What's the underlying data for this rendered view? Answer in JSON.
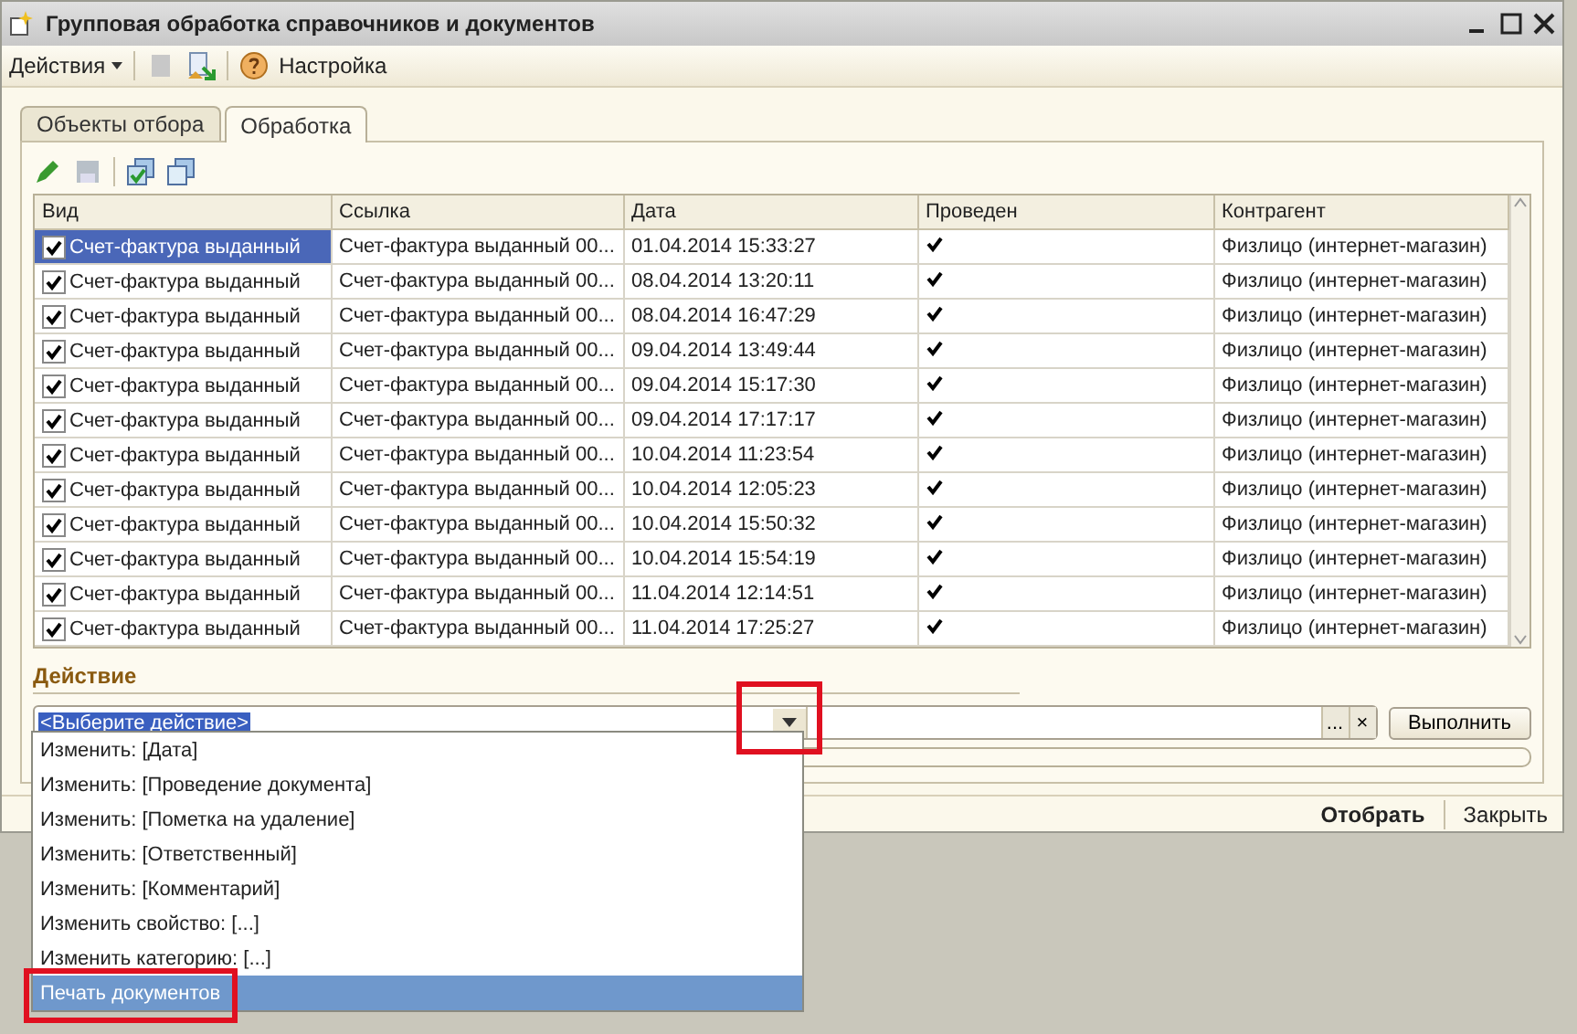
{
  "window": {
    "title": "Групповая обработка справочников и документов"
  },
  "toolbar": {
    "menu": "Действия",
    "settings": "Настройка"
  },
  "tabs": [
    {
      "label": "Объекты отбора",
      "selected": false
    },
    {
      "label": "Обработка",
      "selected": true
    }
  ],
  "table": {
    "columns": [
      "Вид",
      "Ссылка",
      "Дата",
      "Проведен",
      "Контрагент"
    ],
    "rows": [
      {
        "selected": true,
        "checked": true,
        "kind": "Счет-фактура выданный",
        "ref": "Счет-фактура выданный 00...",
        "date": "01.04.2014 15:33:27",
        "posted": true,
        "counterparty": "Физлицо (интернет-магазин)"
      },
      {
        "selected": false,
        "checked": true,
        "kind": "Счет-фактура выданный",
        "ref": "Счет-фактура выданный 00...",
        "date": "08.04.2014 13:20:11",
        "posted": true,
        "counterparty": "Физлицо (интернет-магазин)"
      },
      {
        "selected": false,
        "checked": true,
        "kind": "Счет-фактура выданный",
        "ref": "Счет-фактура выданный 00...",
        "date": "08.04.2014 16:47:29",
        "posted": true,
        "counterparty": "Физлицо (интернет-магазин)"
      },
      {
        "selected": false,
        "checked": true,
        "kind": "Счет-фактура выданный",
        "ref": "Счет-фактура выданный 00...",
        "date": "09.04.2014 13:49:44",
        "posted": true,
        "counterparty": "Физлицо (интернет-магазин)"
      },
      {
        "selected": false,
        "checked": true,
        "kind": "Счет-фактура выданный",
        "ref": "Счет-фактура выданный 00...",
        "date": "09.04.2014 15:17:30",
        "posted": true,
        "counterparty": "Физлицо (интернет-магазин)"
      },
      {
        "selected": false,
        "checked": true,
        "kind": "Счет-фактура выданный",
        "ref": "Счет-фактура выданный 00...",
        "date": "09.04.2014 17:17:17",
        "posted": true,
        "counterparty": "Физлицо (интернет-магазин)"
      },
      {
        "selected": false,
        "checked": true,
        "kind": "Счет-фактура выданный",
        "ref": "Счет-фактура выданный 00...",
        "date": "10.04.2014 11:23:54",
        "posted": true,
        "counterparty": "Физлицо (интернет-магазин)"
      },
      {
        "selected": false,
        "checked": true,
        "kind": "Счет-фактура выданный",
        "ref": "Счет-фактура выданный 00...",
        "date": "10.04.2014 12:05:23",
        "posted": true,
        "counterparty": "Физлицо (интернет-магазин)"
      },
      {
        "selected": false,
        "checked": true,
        "kind": "Счет-фактура выданный",
        "ref": "Счет-фактура выданный 00...",
        "date": "10.04.2014 15:50:32",
        "posted": true,
        "counterparty": "Физлицо (интернет-магазин)"
      },
      {
        "selected": false,
        "checked": true,
        "kind": "Счет-фактура выданный",
        "ref": "Счет-фактура выданный 00...",
        "date": "10.04.2014 15:54:19",
        "posted": true,
        "counterparty": "Физлицо (интернет-магазин)"
      },
      {
        "selected": false,
        "checked": true,
        "kind": "Счет-фактура выданный",
        "ref": "Счет-фактура выданный 00...",
        "date": "11.04.2014 12:14:51",
        "posted": true,
        "counterparty": "Физлицо (интернет-магазин)"
      },
      {
        "selected": false,
        "checked": true,
        "kind": "Счет-фактура выданный",
        "ref": "Счет-фактура выданный 00...",
        "date": "11.04.2014 17:25:27",
        "posted": true,
        "counterparty": "Физлицо (интернет-магазин)"
      }
    ]
  },
  "action": {
    "label": "Действие",
    "value": "<Выберите действие>",
    "dropdown_highlighted": true,
    "ellipsis": "...",
    "clear": "×",
    "run": "Выполнить",
    "progress": {
      "level": 0
    },
    "options": [
      {
        "label": "Изменить: [Дата]",
        "selected": false,
        "highlighted": false
      },
      {
        "label": "Изменить: [Проведение документа]",
        "selected": false,
        "highlighted": false
      },
      {
        "label": "Изменить: [Пометка на удаление]",
        "selected": false,
        "highlighted": false
      },
      {
        "label": "Изменить: [Ответственный]",
        "selected": false,
        "highlighted": false
      },
      {
        "label": "Изменить: [Комментарий]",
        "selected": false,
        "highlighted": false
      },
      {
        "label": "Изменить свойство: [...]",
        "selected": false,
        "highlighted": false
      },
      {
        "label": "Изменить категорию: [...]",
        "selected": false,
        "highlighted": false
      },
      {
        "label": "Печать документов",
        "selected": true,
        "highlighted": true
      }
    ]
  },
  "footer": {
    "select": "Отобрать",
    "close": "Закрыть"
  }
}
